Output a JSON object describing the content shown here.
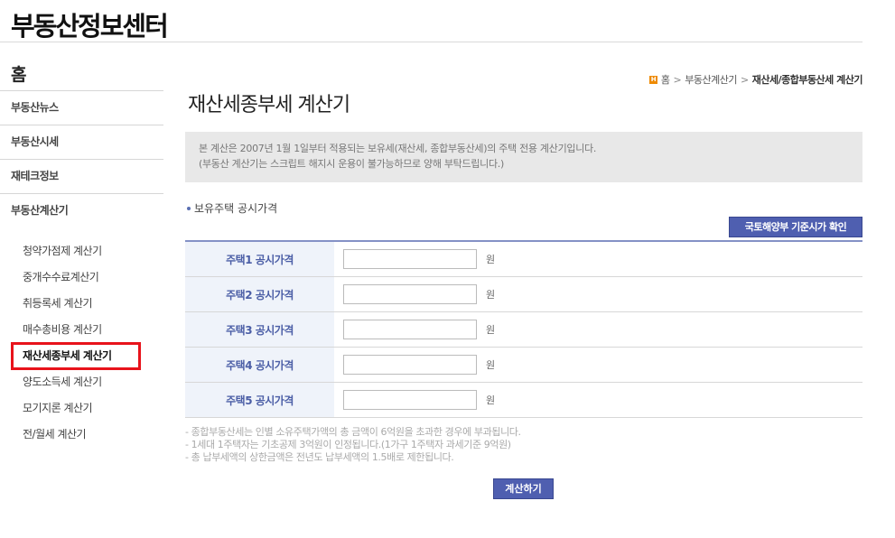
{
  "site": {
    "title": "부동산정보센터"
  },
  "sidebar": {
    "home": "홈",
    "items": [
      {
        "label": "부동산뉴스"
      },
      {
        "label": "부동산시세"
      },
      {
        "label": "재테크정보"
      },
      {
        "label": "부동산계산기"
      }
    ],
    "sub_items": [
      {
        "label": "청약가점제 계산기"
      },
      {
        "label": "중개수수료계산기"
      },
      {
        "label": "취등록세 계산기"
      },
      {
        "label": "매수총비용 계산기"
      },
      {
        "label": "재산세종부세 계산기"
      },
      {
        "label": "양도소득세 계산기"
      },
      {
        "label": "모기지론 계산기"
      },
      {
        "label": "전/월세 계산기"
      }
    ],
    "active_sub_index": 4
  },
  "breadcrumb": {
    "home_icon_glyph": "H",
    "items": [
      "홈",
      "부동산계산기",
      "재산세/종합부동산세 계산기"
    ],
    "separator": ">"
  },
  "page": {
    "title": "재산세종부세 계산기",
    "notice_lines": [
      "본 계산은 2007년 1월 1일부터 적용되는 보유세(재산세, 종합부동산세)의 주택 전용 계산기입니다.",
      "(부동산 계산기는 스크립트 해지시 운용이 불가능하므로 양해 부탁드립니다.)"
    ],
    "section_label": "보유주택 공시가격",
    "ref_button_label": "국토해양부 기준시가 확인",
    "rows": [
      {
        "label": "주택1 공시가격",
        "value": "",
        "unit": "원"
      },
      {
        "label": "주택2 공시가격",
        "value": "",
        "unit": "원"
      },
      {
        "label": "주택3 공시가격",
        "value": "",
        "unit": "원"
      },
      {
        "label": "주택4 공시가격",
        "value": "",
        "unit": "원"
      },
      {
        "label": "주택5 공시가격",
        "value": "",
        "unit": "원"
      }
    ],
    "notes": [
      "- 종합부동산세는 인별 소유주택가액의 총 금액이 6억원을 초과한 경우에 부과됩니다.",
      "- 1세대 1주택자는 기초공제 3억원이 인정됩니다.(1가구 1주택자 과세기준 9억원)",
      "- 총 납부세액의 상한금액은 전년도 납부세액의 1.5배로 제한됩니다."
    ],
    "calc_button_label": "계산하기"
  },
  "colors": {
    "accent": "#4f5fb0",
    "active_highlight": "#e8131b",
    "label_bg": "#eff3fa",
    "home_icon": "#ee8a00"
  }
}
